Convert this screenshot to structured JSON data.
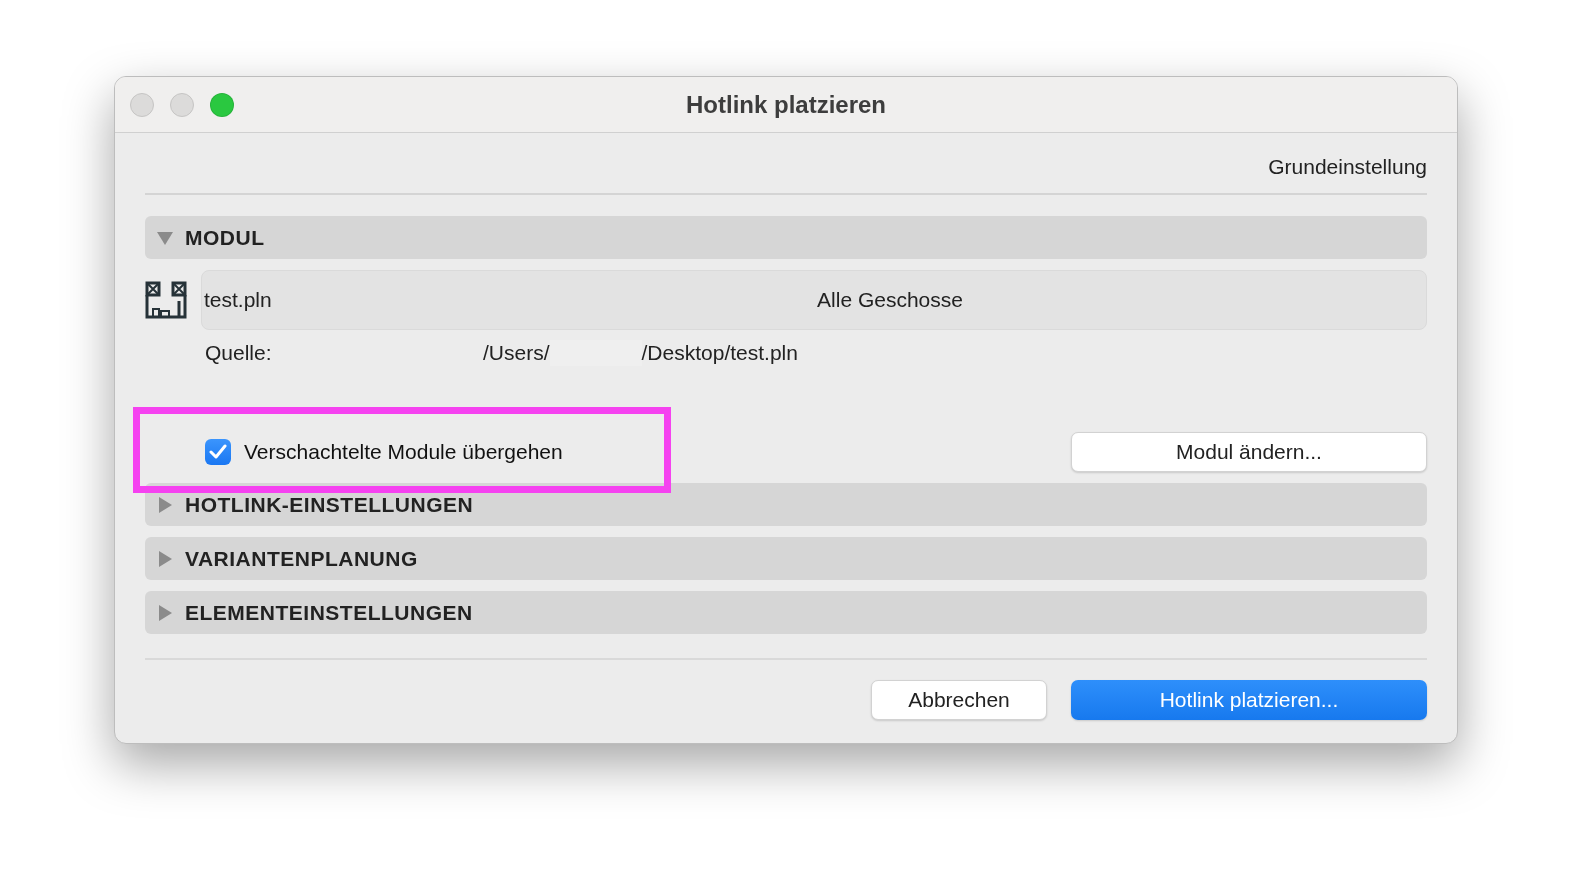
{
  "window": {
    "title": "Hotlink platzieren",
    "controls": [
      {
        "kind": "close",
        "active": false
      },
      {
        "kind": "minimize",
        "active": false
      },
      {
        "kind": "zoom",
        "active": true
      }
    ]
  },
  "preset": "Grundeinstellung",
  "sections": [
    {
      "title": "MODUL",
      "expanded": true,
      "module": {
        "file": "test.pln",
        "stories": "Alle Geschosse",
        "source_label": "Quelle:",
        "source_path_start": "/Users/",
        "source_path_end": "/Desktop/test.pln",
        "skip_nested": {
          "label": "Verschachtelte Module übergehen",
          "checked": true
        },
        "change_button": "Modul ändern...",
        "highlighted": true
      }
    },
    {
      "title": "HOTLINK-EINSTELLUNGEN",
      "expanded": false
    },
    {
      "title": "VARIANTENPLANUNG",
      "expanded": false
    },
    {
      "title": "ELEMENTEINSTELLUNGEN",
      "expanded": false
    }
  ],
  "buttons": [
    {
      "label": "Abbrechen",
      "primary": false
    },
    {
      "label": "Hotlink platzieren...",
      "primary": true
    }
  ]
}
